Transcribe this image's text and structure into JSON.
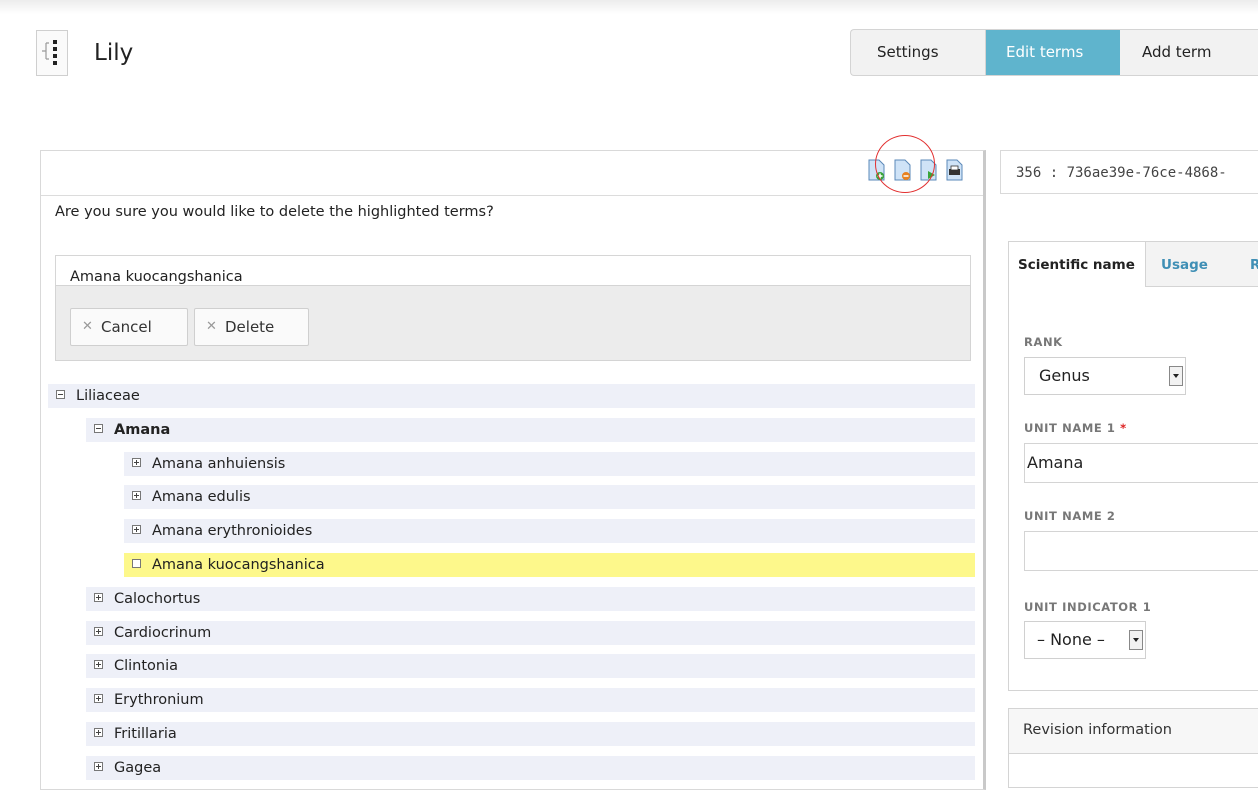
{
  "header": {
    "title": "Lily",
    "tabs": [
      "Settings",
      "Edit terms",
      "Add term"
    ]
  },
  "toolbar": {
    "icons": [
      "add-term-icon",
      "delete-term-icon",
      "move-term-icon",
      "print-icon"
    ]
  },
  "confirm": {
    "message": "Are you sure you would like to delete the highlighted terms?",
    "terms": "Amana kuocangshanica",
    "cancel_label": "Cancel",
    "delete_label": "Delete"
  },
  "tree": [
    {
      "label": "Liliaceae",
      "state": "expanded",
      "level": 0
    },
    {
      "label": "Amana",
      "state": "expanded",
      "level": 1,
      "bold": true
    },
    {
      "label": "Amana anhuiensis",
      "state": "collapsed",
      "level": 2
    },
    {
      "label": "Amana edulis",
      "state": "collapsed",
      "level": 2
    },
    {
      "label": "Amana erythronioides",
      "state": "collapsed",
      "level": 2
    },
    {
      "label": "Amana kuocangshanica",
      "state": "leaf",
      "level": 2,
      "highlighted": true
    },
    {
      "label": "Calochortus",
      "state": "collapsed",
      "level": 1
    },
    {
      "label": "Cardiocrinum",
      "state": "collapsed",
      "level": 1
    },
    {
      "label": "Clintonia",
      "state": "collapsed",
      "level": 1
    },
    {
      "label": "Erythronium",
      "state": "collapsed",
      "level": 1
    },
    {
      "label": "Fritillaria",
      "state": "collapsed",
      "level": 1
    },
    {
      "label": "Gagea",
      "state": "collapsed",
      "level": 1
    }
  ],
  "editor": {
    "term_id": "356 : 736ae39e-76ce-4868-",
    "tabs": [
      "Scientific name",
      "Usage",
      "R"
    ],
    "rank_label": "RANK",
    "rank_value": "Genus",
    "unit_name_1_label": "UNIT NAME 1",
    "required_mark": "*",
    "unit_name_1_value": "Amana",
    "unit_name_2_label": "UNIT NAME 2",
    "unit_name_2_value": "",
    "unit_indicator_1_label": "UNIT INDICATOR 1",
    "unit_indicator_1_value": "– None –",
    "revision_title": "Revision information"
  },
  "colors": {
    "active_tab": "#5fb4cd",
    "highlight_row": "#fdf88b",
    "tree_row": "#eef0f8",
    "link": "#3f8fb5",
    "annotation_circle": "#e23030"
  }
}
